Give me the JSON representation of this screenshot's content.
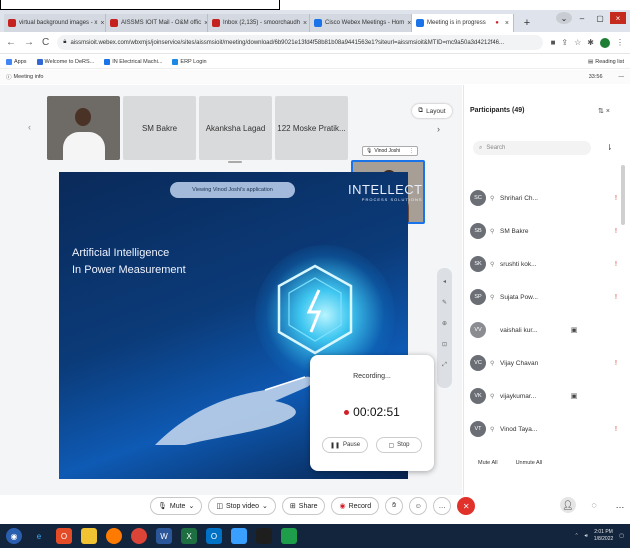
{
  "browser": {
    "tabs": [
      {
        "label": "virtual background images - x",
        "favicon_color": "#c5221f"
      },
      {
        "label": "AISSMS IOIT Mail - O&M offic",
        "favicon_color": "#c5221f"
      },
      {
        "label": "Inbox (2,135) - smoorchaudh",
        "favicon_color": "#c5221f"
      },
      {
        "label": "Cisco Webex Meetings - Hom",
        "favicon_color": "#1a73e8"
      },
      {
        "label": "Meeting is in progress",
        "favicon_color": "#1a73e8",
        "active": true
      }
    ],
    "url": "aissmsioit.webex.com/wbxmjs/joinservice/sites/aissmsioit/meeting/download/6b9021e13fd4f58b81b08a9441563e1?siteurl=aissmsioit&MTID=mc9a50a3d4212f46...",
    "bookmarks": [
      {
        "label": "Apps",
        "color": "#4285f4"
      },
      {
        "label": "Welcome to DeRS...",
        "color": "#3367d6"
      },
      {
        "label": "IN Electrical Machi...",
        "color": "#1a73e8"
      },
      {
        "label": "ERP Login",
        "color": "#1e88e5"
      }
    ],
    "reading_list": "Reading list",
    "meeting_info": "Meeting info",
    "time": "33:56"
  },
  "meeting": {
    "thumbnails": [
      {
        "label": ""
      },
      {
        "label": "SM Bakre"
      },
      {
        "label": "Akanksha Lagad"
      },
      {
        "label": "122 Moske Pratik..."
      },
      {
        "label": ""
      }
    ],
    "active_speaker_name": "Vinod Joshi",
    "layout_label": "Layout",
    "viewing_label": "Viewing Vinod Joshi's application",
    "brand_title": "INTELLECT",
    "brand_sub": "PROCESS SOLUTIONS",
    "slide_title_1": "Artificial Intelligence",
    "slide_title_2": "In Power Measurement",
    "recording": {
      "title": "Recording...",
      "time": "00:02:51",
      "pause": "Pause",
      "stop": "Stop"
    },
    "controls": {
      "mute": "Mute",
      "stop_video": "Stop video",
      "share": "Share",
      "record": "Record"
    }
  },
  "participants": {
    "title": "Participants (49)",
    "search_placeholder": "Search",
    "rows": [
      {
        "initials": "SC",
        "name": "Shrihari Ch...",
        "extra": "!"
      },
      {
        "initials": "SB",
        "name": "SM Bakre",
        "extra": "!"
      },
      {
        "initials": "SK",
        "name": "srushti kok...",
        "extra": "!"
      },
      {
        "initials": "SP",
        "name": "Sujata Pow...",
        "extra": "!"
      },
      {
        "initials": "VV",
        "name": "vaishali kur...",
        "extra": "▣"
      },
      {
        "initials": "VC",
        "name": "Vijay Chavan",
        "extra": "!"
      },
      {
        "initials": "VK",
        "name": "vijaykumar...",
        "extra": "▣"
      },
      {
        "initials": "VT",
        "name": "Vinod Taya...",
        "extra": "!"
      }
    ],
    "mute_all": "Mute All",
    "unmute_all": "Unmute All"
  },
  "taskbar": {
    "clock_time": "2:01 PM",
    "clock_date": "1/8/2022"
  },
  "colors": {
    "accent": "#1a73e8",
    "record_red": "#d21f2a",
    "leave_red": "#e0312b",
    "taskbar": "#13243d"
  }
}
